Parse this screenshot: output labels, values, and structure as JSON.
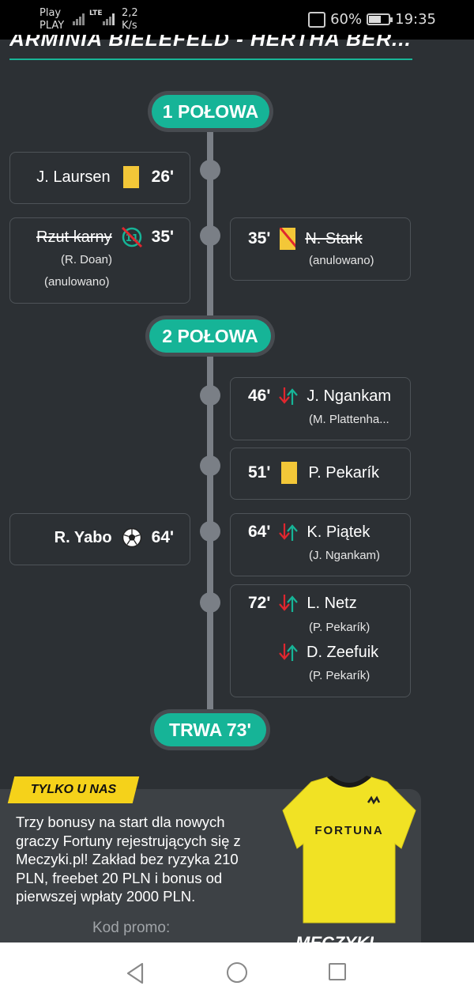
{
  "status_bar": {
    "carrier_line1": "Play",
    "carrier_line2": "PLAY",
    "network": "LTE",
    "speed_value": "2,2",
    "speed_unit": "K/s",
    "battery": "60%",
    "battery_level": 0.6,
    "time": "19:35",
    "icons": [
      "signal-icon",
      "vibrate-icon",
      "battery-icon"
    ]
  },
  "header": {
    "title": "ARMINIA BIELEFELD - HERTHA BER..."
  },
  "timeline": {
    "half1": "1 POŁOWA",
    "half2": "2 POŁOWA",
    "live": "TRWA 73'",
    "events": {
      "laursen": {
        "name": "J. Laursen",
        "minute": "26'",
        "icon": "yellow-card-icon"
      },
      "penalty": {
        "name": "Rzut karny",
        "minute": "35'",
        "sub1": "(R. Doan)",
        "sub2": "(anulowano)",
        "icon": "cancelled-penalty-icon"
      },
      "stark": {
        "name": "N. Stark",
        "minute": "35'",
        "sub": "(anulowano)",
        "icon": "cancelled-card-icon"
      },
      "ngankam": {
        "name": "J. Ngankam",
        "minute": "46'",
        "sub": "(M. Plattenha...",
        "icon": "substitution-icon"
      },
      "pekarik": {
        "name": "P. Pekarík",
        "minute": "51'",
        "icon": "yellow-card-icon"
      },
      "yabo": {
        "name": "R. Yabo",
        "minute": "64'",
        "icon": "football-icon"
      },
      "piatek": {
        "name": "K. Piątek",
        "minute": "64'",
        "sub": "(J. Ngankam)",
        "icon": "substitution-icon"
      },
      "netz": {
        "name": "L. Netz",
        "minute": "72'",
        "sub": "(P. Pekarík)",
        "icon": "substitution-icon"
      },
      "zeefuik": {
        "name": "D. Zeefuik",
        "sub": "(P. Pekarík)",
        "icon": "substitution-icon"
      }
    }
  },
  "promo": {
    "tag": "TYLKO U NAS",
    "text": "Trzy bonusy na start dla nowych graczy Fortuny rejestrujących się z Meczyki.pl! Zakład bez ryzyka 210 PLN, freebet 20 PLN i bonus od pierwszej wpłaty 2000 PLN.",
    "code_label": "Kod promo:",
    "jersey_text": "FORTUNA",
    "logo": "MECZYKI"
  },
  "colors": {
    "accent": "#16b497",
    "background": "#2c3034",
    "card": "#f3c738",
    "promo_tag": "#f5d21a"
  },
  "nav": {
    "icons": [
      "back-icon",
      "home-icon",
      "recent-apps-icon"
    ]
  }
}
